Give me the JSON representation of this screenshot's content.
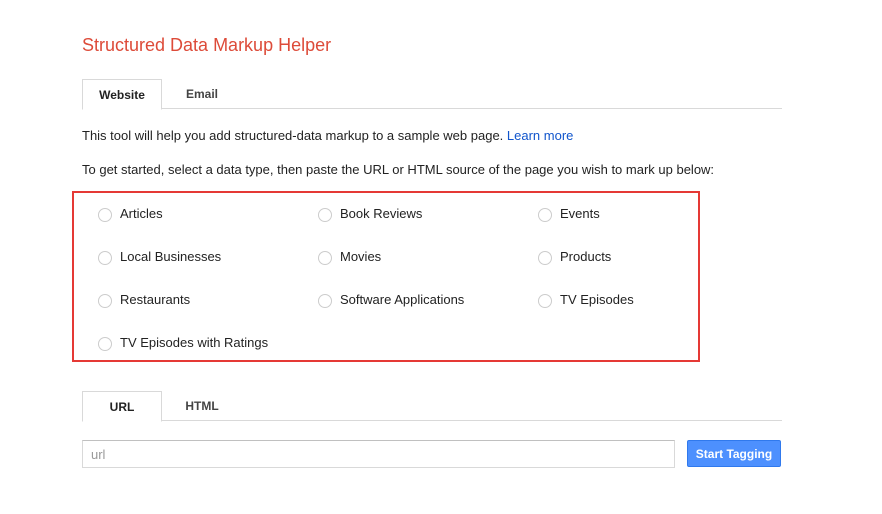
{
  "header": {
    "title": "Structured Data Markup Helper"
  },
  "source_tabs": [
    {
      "label": "Website",
      "active": true
    },
    {
      "label": "Email",
      "active": false
    }
  ],
  "intro": {
    "text": "This tool will help you add structured-data markup to a sample web page. ",
    "learn_more": "Learn more"
  },
  "instructions": "To get started, select a data type, then paste the URL or HTML source of the page you wish to mark up below:",
  "data_types": [
    {
      "label": "Articles"
    },
    {
      "label": "Book Reviews"
    },
    {
      "label": "Events"
    },
    {
      "label": "Local Businesses"
    },
    {
      "label": "Movies"
    },
    {
      "label": "Products"
    },
    {
      "label": "Restaurants"
    },
    {
      "label": "Software Applications"
    },
    {
      "label": "TV Episodes"
    },
    {
      "label": "TV Episodes with Ratings"
    }
  ],
  "input_tabs": [
    {
      "label": "URL",
      "active": true
    },
    {
      "label": "HTML",
      "active": false
    }
  ],
  "url_input": {
    "placeholder": "url",
    "value": ""
  },
  "start_button": {
    "label": "Start Tagging"
  },
  "colors": {
    "title": "#dd4b39",
    "link": "#1155cc",
    "button": "#4d90fe",
    "highlight": "#e53935"
  }
}
